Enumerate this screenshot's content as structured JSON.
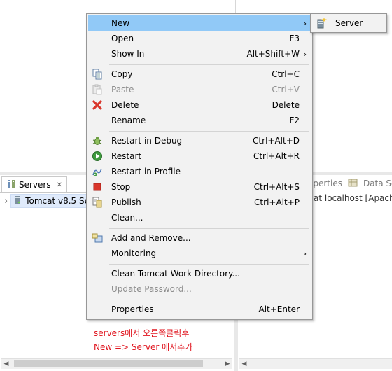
{
  "servers_view": {
    "tab_label": "Servers",
    "tab_close": "✕",
    "tree_expand": "›",
    "server_item": "Tomcat v8.5 Se"
  },
  "right_panel": {
    "tab_properties": "operties",
    "tab_data_source": "Data Sc",
    "console_text": "at localhost [Apache"
  },
  "context_menu": {
    "items": [
      {
        "label": "New",
        "shortcut": "",
        "arrow": "›",
        "icon": "",
        "highlighted": true,
        "disabled": false
      },
      {
        "label": "Open",
        "shortcut": "F3",
        "icon": ""
      },
      {
        "label": "Show In",
        "shortcut": "Alt+Shift+W",
        "arrow": "›",
        "icon": ""
      },
      {
        "label": "Copy",
        "shortcut": "Ctrl+C",
        "icon": "copy-icon"
      },
      {
        "label": "Paste",
        "shortcut": "Ctrl+V",
        "icon": "paste-icon",
        "disabled": true
      },
      {
        "label": "Delete",
        "shortcut": "Delete",
        "icon": "delete-icon"
      },
      {
        "label": "Rename",
        "shortcut": "F2",
        "icon": ""
      },
      {
        "label": "Restart in Debug",
        "shortcut": "Ctrl+Alt+D",
        "icon": "debug-bug-icon"
      },
      {
        "label": "Restart",
        "shortcut": "Ctrl+Alt+R",
        "icon": "run-icon"
      },
      {
        "label": "Restart in Profile",
        "shortcut": "",
        "icon": "profile-icon"
      },
      {
        "label": "Stop",
        "shortcut": "Ctrl+Alt+S",
        "icon": "stop-icon"
      },
      {
        "label": "Publish",
        "shortcut": "Ctrl+Alt+P",
        "icon": "publish-icon"
      },
      {
        "label": "Clean...",
        "shortcut": "",
        "icon": ""
      },
      {
        "label": "Add and Remove...",
        "shortcut": "",
        "icon": "add-remove-icon"
      },
      {
        "label": "Monitoring",
        "shortcut": "",
        "arrow": "›",
        "icon": ""
      },
      {
        "label": "Clean Tomcat Work Directory...",
        "shortcut": "",
        "icon": ""
      },
      {
        "label": "Update Password...",
        "shortcut": "",
        "icon": "",
        "disabled": true
      },
      {
        "label": "Properties",
        "shortcut": "Alt+Enter",
        "icon": ""
      }
    ]
  },
  "submenu_new": {
    "items": [
      {
        "label": "Server",
        "icon": "new-server-icon"
      }
    ]
  },
  "annotation": {
    "line1": "servers에서 오른쪽클릭후",
    "line2": "New => Server 에서추가"
  },
  "colors": {
    "highlight": "#91c9f7",
    "annotation": "#e0141e",
    "menu_bg": "#f2f2f2"
  }
}
